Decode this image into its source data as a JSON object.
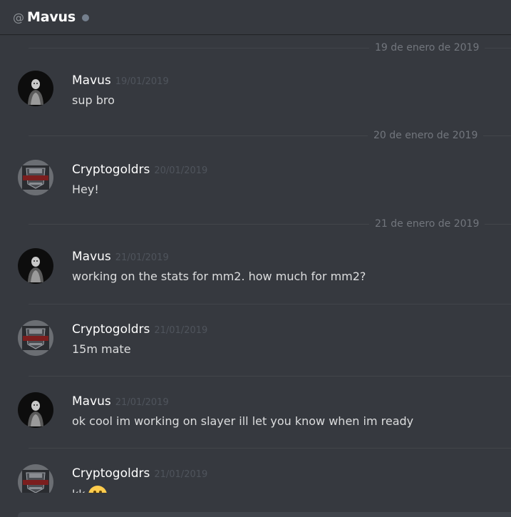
{
  "header": {
    "at_symbol": "@",
    "name": "Mavus",
    "status": "offline"
  },
  "dividers": [
    "19 de enero de 2019",
    "20 de enero de 2019",
    "21 de enero de 2019"
  ],
  "messages": [
    {
      "author": "Mavus",
      "time": "19/01/2019",
      "text": "sup bro"
    },
    {
      "author": "Cryptogoldrs",
      "time": "20/01/2019",
      "text": "Hey!"
    },
    {
      "author": "Mavus",
      "time": "21/01/2019",
      "text": "working on the stats for mm2. how much for mm2?"
    },
    {
      "author": "Cryptogoldrs",
      "time": "21/01/2019",
      "text": "15m mate"
    },
    {
      "author": "Mavus",
      "time": "21/01/2019",
      "text": "ok cool im working on slayer ill let you know when im ready"
    },
    {
      "author": "Cryptogoldrs",
      "time": "21/01/2019",
      "text": "kk"
    }
  ],
  "colors": {
    "background": "#36393f",
    "username": "#ffffff",
    "timestamp": "#4f545c",
    "divider_text": "#72767d",
    "offline_dot": "#747f8d"
  },
  "icons": {
    "mavus_avatar": "dark-figure-avatar",
    "crypto_avatar": "crypto-gold-logo-avatar",
    "emoji": "smiley-emoji"
  }
}
